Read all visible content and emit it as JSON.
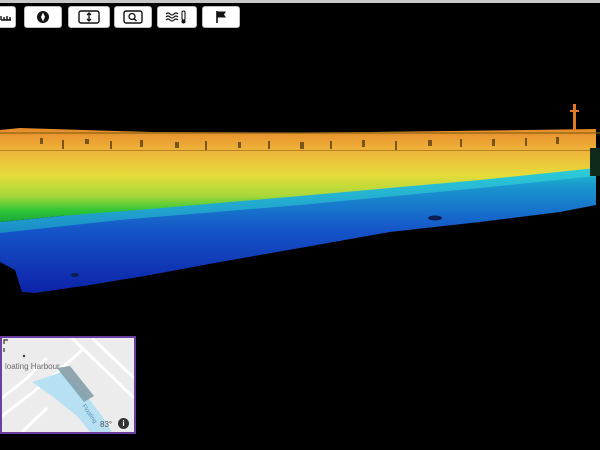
{
  "toolbar": {
    "buttons": [
      {
        "id": "measure",
        "icon": "ruler-icon"
      },
      {
        "id": "compass",
        "icon": "compass-icon"
      },
      {
        "id": "frame",
        "icon": "fit-view-icon"
      },
      {
        "id": "zoom",
        "icon": "zoom-icon"
      },
      {
        "id": "water",
        "icon": "water-level-icon"
      },
      {
        "id": "flag",
        "icon": "flag-icon"
      }
    ]
  },
  "minimap": {
    "place_label": "loating Harbour",
    "heading": "83°",
    "info_icon": "info-icon",
    "water_label": "Floating Harbour"
  },
  "colors": {
    "background": "#000000",
    "minimap_border": "#6b3fa0",
    "water": "#b7e1f3",
    "footprint": "#7f9aa6"
  }
}
